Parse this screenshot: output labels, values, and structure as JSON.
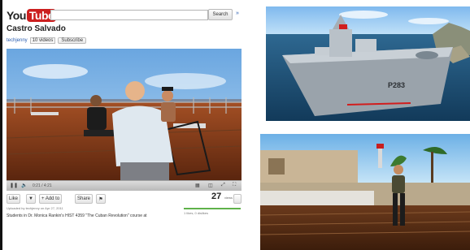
{
  "youtube": {
    "logo_you": "You",
    "logo_tube": "Tube",
    "search_button": "Search",
    "header_more": "»",
    "video_title": "Castro Salvado",
    "channel": "techjenny",
    "videos_count": "10 videos",
    "subscribe": "Subscribe",
    "time": "0:21 / 4:21",
    "actions": {
      "like": "Like",
      "add_to": "+ Add to",
      "share": "Share"
    },
    "views_count": "27",
    "views_label": "views",
    "uploaded": "Uploaded by techjenny on Apr 27, 2011",
    "likes_text": "1 likes, 0 dislikes",
    "description": "Students in Dr. Monica Rankin's HIST 4359 \"The Cuban Revolution\" course at"
  },
  "ship": {
    "hull_number": "P283"
  }
}
